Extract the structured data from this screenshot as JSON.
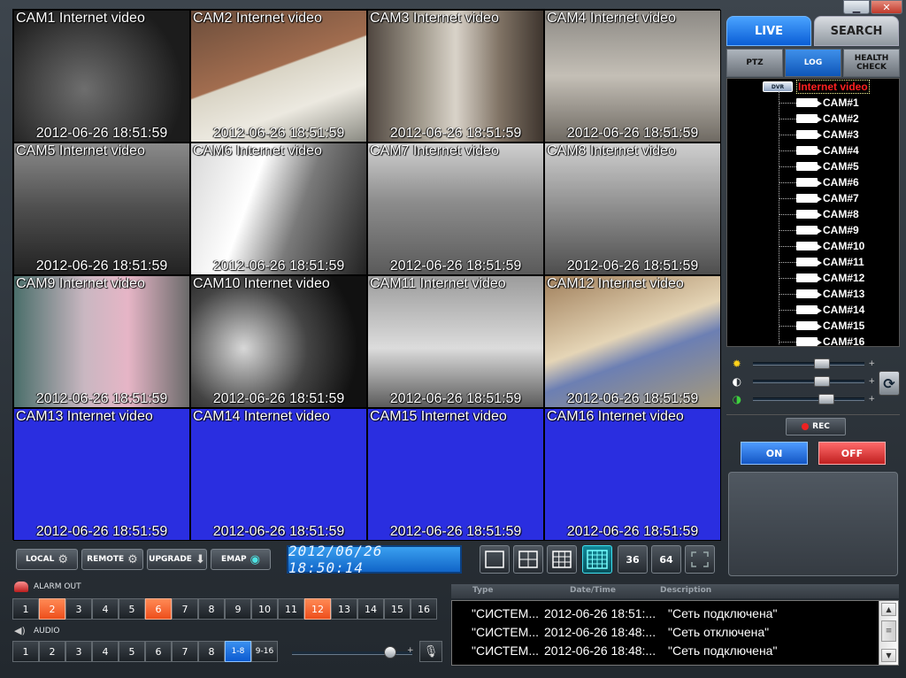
{
  "window": {
    "minimize_label": "▁",
    "close_label": "✕"
  },
  "cameras": [
    {
      "title": "CAM1  Internet video",
      "timestamp": "2012-06-26 18:51:59",
      "scene": "s1"
    },
    {
      "title": "CAM2  Internet video",
      "timestamp": "2012-06-26 18:51:59",
      "scene": "s2"
    },
    {
      "title": "CAM3  Internet video",
      "timestamp": "2012-06-26 18:51:59",
      "scene": "s3"
    },
    {
      "title": "CAM4  Internet video",
      "timestamp": "2012-06-26 18:51:59",
      "scene": "s4"
    },
    {
      "title": "CAM5  Internet video",
      "timestamp": "2012-06-26 18:51:59",
      "scene": "s5"
    },
    {
      "title": "CAM6  Internet video",
      "timestamp": "2012-06-26 18:51:59",
      "scene": "s6"
    },
    {
      "title": "CAM7  Internet video",
      "timestamp": "2012-06-26 18:51:59",
      "scene": "s7"
    },
    {
      "title": "CAM8  Internet video",
      "timestamp": "2012-06-26 18:51:59",
      "scene": "s8"
    },
    {
      "title": "CAM9  Internet video",
      "timestamp": "2012-06-26 18:51:59",
      "scene": "s9"
    },
    {
      "title": "CAM10  Internet video",
      "timestamp": "2012-06-26 18:51:59",
      "scene": "s10"
    },
    {
      "title": "CAM11  Internet video",
      "timestamp": "2012-06-26 18:51:59",
      "scene": "s11"
    },
    {
      "title": "CAM12  Internet video",
      "timestamp": "2012-06-26 18:51:59",
      "scene": "s12"
    },
    {
      "title": "CAM13  Internet video",
      "timestamp": "2012-06-26 18:51:59",
      "scene": "blue"
    },
    {
      "title": "CAM14  Internet video",
      "timestamp": "2012-06-26 18:51:59",
      "scene": "blue"
    },
    {
      "title": "CAM15  Internet video",
      "timestamp": "2012-06-26 18:51:59",
      "scene": "blue"
    },
    {
      "title": "CAM16  Internet video",
      "timestamp": "2012-06-26 18:51:59",
      "scene": "blue"
    }
  ],
  "tabs": {
    "live": "LIVE",
    "search": "SEARCH"
  },
  "subtabs": {
    "ptz": "PTZ",
    "log": "LOG",
    "health_line1": "HEALTH",
    "health_line2": "CHECK"
  },
  "tree": {
    "badge": "DVR",
    "root_label": "Internet video",
    "items": [
      "CAM#1",
      "CAM#2",
      "CAM#3",
      "CAM#4",
      "CAM#5",
      "CAM#6",
      "CAM#7",
      "CAM#8",
      "CAM#9",
      "CAM#10",
      "CAM#11",
      "CAM#12",
      "CAM#13",
      "CAM#14",
      "CAM#15",
      "CAM#16"
    ]
  },
  "image_adjust": {
    "brightness": 0.62,
    "contrast": 0.62,
    "color": 0.66
  },
  "record": {
    "rec_label": "REC",
    "on_label": "ON",
    "off_label": "OFF"
  },
  "toolbar": {
    "local_label": "LOCAL",
    "remote_label": "REMOTE",
    "upgrade_label": "UPGRADE",
    "emap_label": "EMAP",
    "clock": "2012/06/26 18:50:14",
    "layout_36": "36",
    "layout_64": "64"
  },
  "alarm_out": {
    "label": "ALARM OUT",
    "buttons": [
      "1",
      "2",
      "3",
      "4",
      "5",
      "6",
      "7",
      "8",
      "9",
      "10",
      "11",
      "12",
      "13",
      "14",
      "15",
      "16"
    ],
    "active": [
      "2",
      "6",
      "12"
    ]
  },
  "audio": {
    "label": "AUDIO",
    "buttons": [
      "1",
      "2",
      "3",
      "4",
      "5",
      "6",
      "7",
      "8"
    ],
    "group_a": "1-8",
    "group_b": "9-16",
    "volume": 0.85,
    "plus": "+"
  },
  "log": {
    "headers": {
      "type": "Type",
      "datetime": "Date/Time",
      "description": "Description"
    },
    "rows": [
      {
        "type": "\"СИСТЕМ...",
        "datetime": "2012-06-26 18:51:...",
        "description": "\"Сеть подключена\""
      },
      {
        "type": "\"СИСТЕМ...",
        "datetime": "2012-06-26 18:48:...",
        "description": "\"Сеть отключена\""
      },
      {
        "type": "\"СИСТЕМ...",
        "datetime": "2012-06-26 18:48:...",
        "description": "\"Сеть подключена\""
      }
    ]
  },
  "icons": {
    "brightness": "sun-icon",
    "contrast": "contrast-icon",
    "color": "color-icon",
    "refresh": "refresh-icon",
    "gear": "gear-icon",
    "mic": "microphone-icon"
  }
}
